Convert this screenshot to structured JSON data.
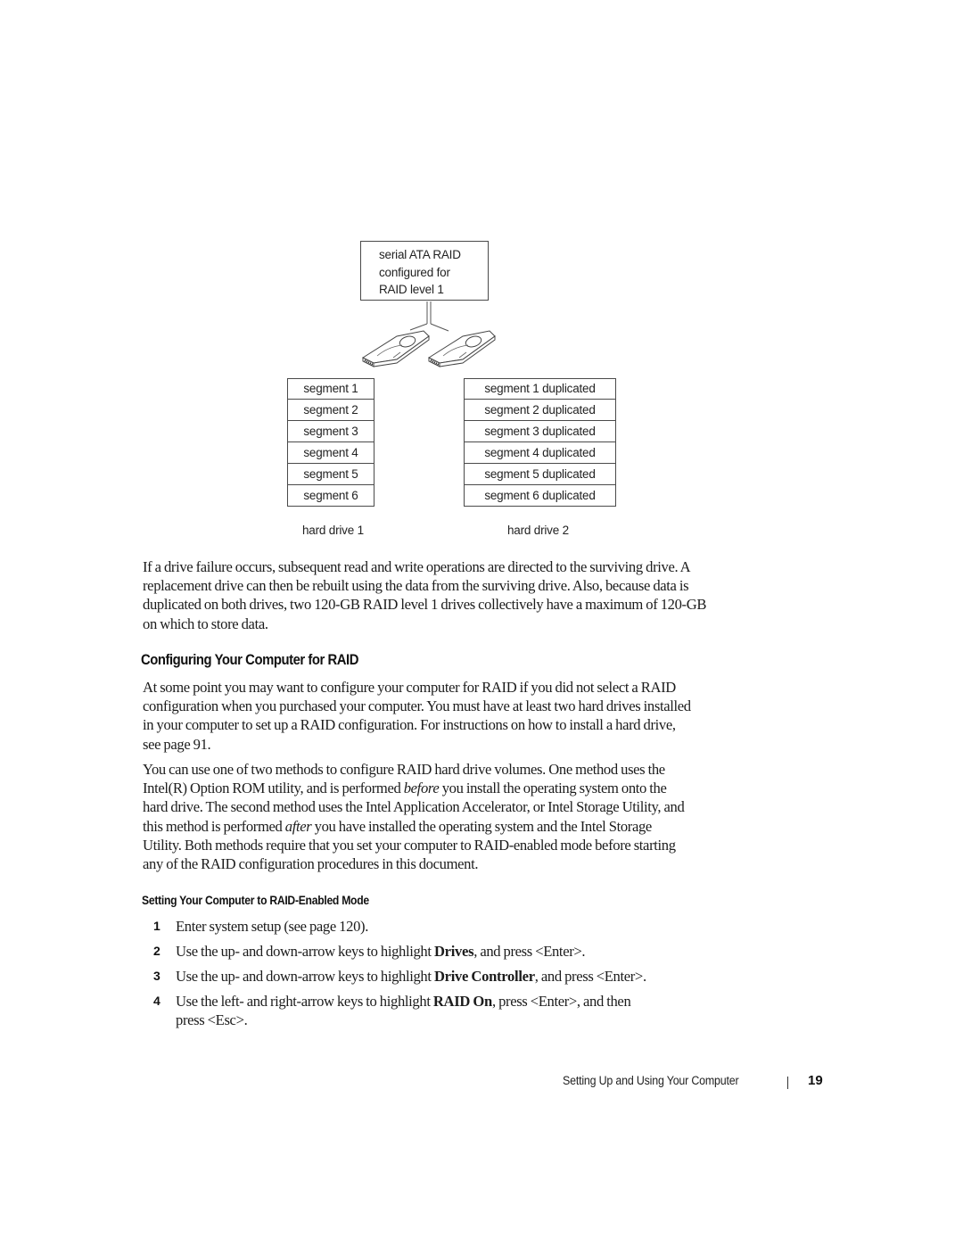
{
  "diagram": {
    "controller_label_lines": [
      "serial ATA RAID",
      "configured for",
      "RAID level 1"
    ],
    "icons": [
      "hard-drive-icon",
      "hard-drive-icon"
    ],
    "drive1": {
      "label": "hard drive 1",
      "segments": [
        "segment 1",
        "segment 2",
        "segment 3",
        "segment 4",
        "segment 5",
        "segment 6"
      ]
    },
    "drive2": {
      "label": "hard drive 2",
      "segments": [
        "segment 1 duplicated",
        "segment 2 duplicated",
        "segment 3 duplicated",
        "segment 4 duplicated",
        "segment 5 duplicated",
        "segment 6 duplicated"
      ]
    }
  },
  "body": {
    "para_failure": [
      "If a drive failure occurs, subsequent read and write operations are directed to the surviving drive. A",
      "replacement drive can then be rebuilt using the data from the surviving drive. Also, because data is",
      "duplicated on both drives, two 120-GB RAID level 1 drives collectively have a maximum of 120-GB",
      "on which to store data."
    ],
    "heading_configuring": "Configuring Your Computer for RAID",
    "para_configure": [
      "At some point you may want to configure your computer for RAID if you did not select a RAID",
      "configuration when you purchased your computer. You must have at least two hard drives installed",
      "in your computer to set up a RAID configuration. For instructions on how to install a hard drive,",
      "see page 91."
    ],
    "para_methods": {
      "l1": "You can use one of two methods to configure RAID hard drive volumes. One method uses the",
      "l2_a": "Intel(R) Option ROM utility, and is performed ",
      "l2_em": "before",
      "l2_b": " you install the operating system onto the",
      "l3": "hard drive. The second method uses the Intel Application Accelerator, or Intel Storage Utility, and",
      "l4_a": "this method is performed ",
      "l4_em": "after",
      "l4_b": " you have installed the operating system and the Intel Storage",
      "l5": "Utility. Both methods require that you set your computer to RAID-enabled mode before starting",
      "l6": "any of the RAID configuration procedures in this document."
    },
    "subheading": "Setting Your Computer to RAID-Enabled Mode",
    "steps": [
      {
        "num": "1",
        "a": "Enter system setup (see page 120).",
        "ui": "",
        "b": ""
      },
      {
        "num": "2",
        "a": "Use the up- and down-arrow keys to highlight ",
        "ui": "Drives",
        "b": ", and press <Enter>."
      },
      {
        "num": "3",
        "a": "Use the up- and down-arrow keys to highlight ",
        "ui": "Drive Controller",
        "b": ", and press <Enter>."
      },
      {
        "num": "4",
        "a": "Use the left- and right-arrow keys to highlight ",
        "ui": "RAID On",
        "b": ", press <Enter>, and then",
        "l2": "press <Esc>."
      }
    ]
  },
  "footer": {
    "section_title": "Setting Up and Using Your Computer",
    "page_number": "19"
  }
}
